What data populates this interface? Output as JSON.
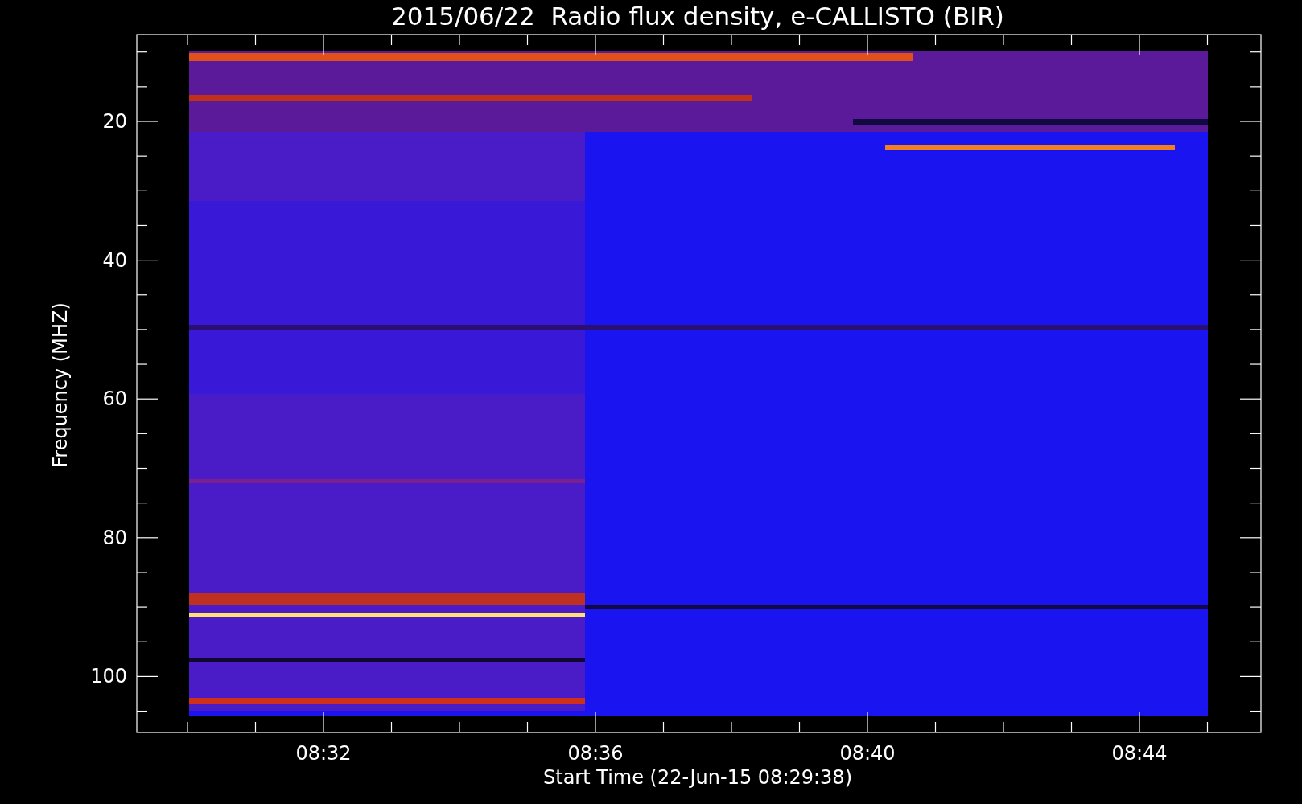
{
  "title": "2015/06/22  Radio flux density, e-CALLISTO (BIR)",
  "ylabel": "Frequency (MHZ)",
  "xlabel": "Start Time (22-Jun-15 08:29:38)",
  "yticks": [
    "20",
    "40",
    "60",
    "80",
    "100"
  ],
  "xticks": [
    "08:32",
    "08:36",
    "08:40",
    "08:44"
  ]
}
